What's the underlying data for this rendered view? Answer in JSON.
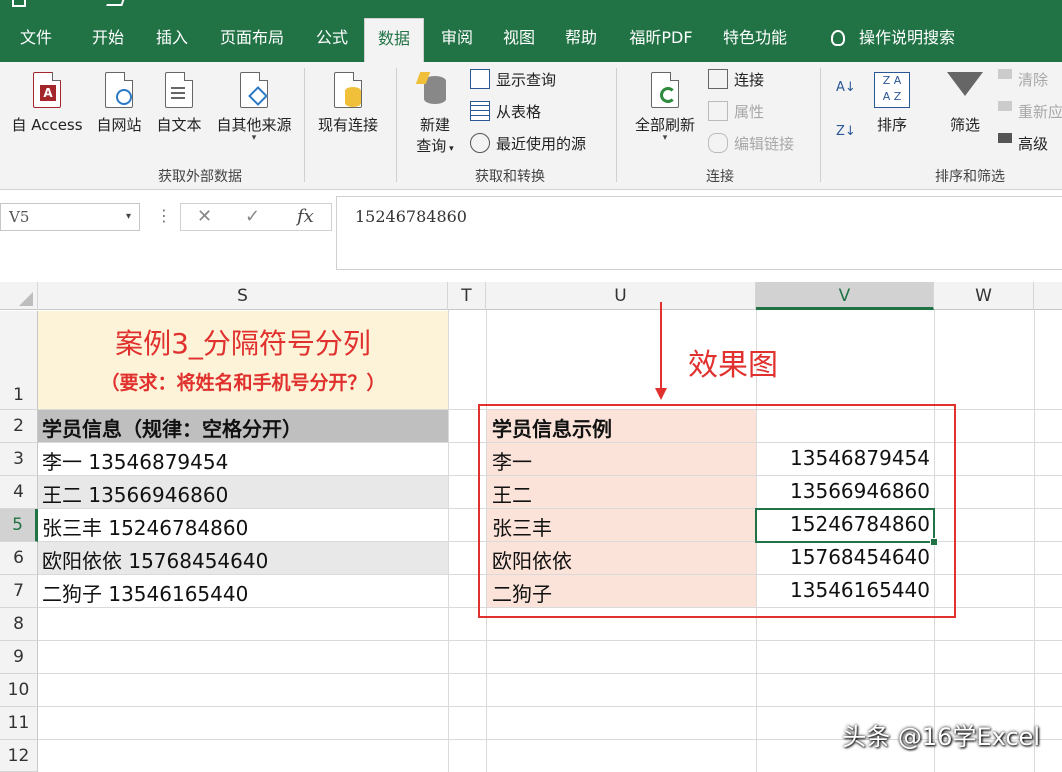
{
  "tabs": [
    {
      "label": "文件"
    },
    {
      "label": "开始"
    },
    {
      "label": "插入"
    },
    {
      "label": "页面布局"
    },
    {
      "label": "公式"
    },
    {
      "label": "数据"
    },
    {
      "label": "审阅"
    },
    {
      "label": "视图"
    },
    {
      "label": "帮助"
    },
    {
      "label": "福昕PDF"
    },
    {
      "label": "特色功能"
    },
    {
      "label": "操作说明搜索"
    }
  ],
  "ribbon": {
    "get_external": {
      "group_label": "获取外部数据",
      "buttons": [
        "自 Access",
        "自网站",
        "自文本",
        "自其他来源"
      ]
    },
    "existing_conn": "现有连接",
    "get_transform": {
      "group_label": "获取和转换",
      "new_query_line1": "新建",
      "new_query_line2": "查询",
      "show_query": "显示查询",
      "from_table": "从表格",
      "recent_sources": "最近使用的源"
    },
    "connections": {
      "group_label": "连接",
      "refresh_all": "全部刷新",
      "connections": "连接",
      "properties": "属性",
      "edit_links": "编辑链接"
    },
    "sort_filter": {
      "group_label": "排序和筛选",
      "sort": "排序",
      "filter": "筛选",
      "clear": "清除",
      "reapply": "重新应用",
      "advanced": "高级"
    }
  },
  "formula_bar": {
    "name_box": "V5",
    "formula": "15246784860"
  },
  "columns": [
    "S",
    "T",
    "U",
    "V",
    "W"
  ],
  "rows": [
    "1",
    "2",
    "3",
    "4",
    "5",
    "6",
    "7",
    "8",
    "9",
    "10",
    "11",
    "12"
  ],
  "sheet": {
    "title_line1": "案例3_分隔符号分列",
    "title_line2": "（要求：将姓名和手机号分开？）",
    "s_header": "学员信息（规律：空格分开）",
    "s_values": [
      "李一 13546879454",
      "王二 13566946860",
      "张三丰 15246784860",
      "欧阳依依 15768454640",
      "二狗子 13546165440"
    ],
    "effect_label": "效果图",
    "u_header": "学员信息示例",
    "names": [
      "李一",
      "王二",
      "张三丰",
      "欧阳依依",
      "二狗子"
    ],
    "phones": [
      "13546879454",
      "13566946860",
      "15246784860",
      "15768454640",
      "13546165440"
    ]
  },
  "watermark": "头条 @16学Excel",
  "colors": {
    "excel_green": "#217346",
    "annotation_red": "#e0312e",
    "header_grey": "#bfbfbf",
    "pink_fill": "#fbe3d9",
    "title_fill": "#fdf3d8"
  }
}
